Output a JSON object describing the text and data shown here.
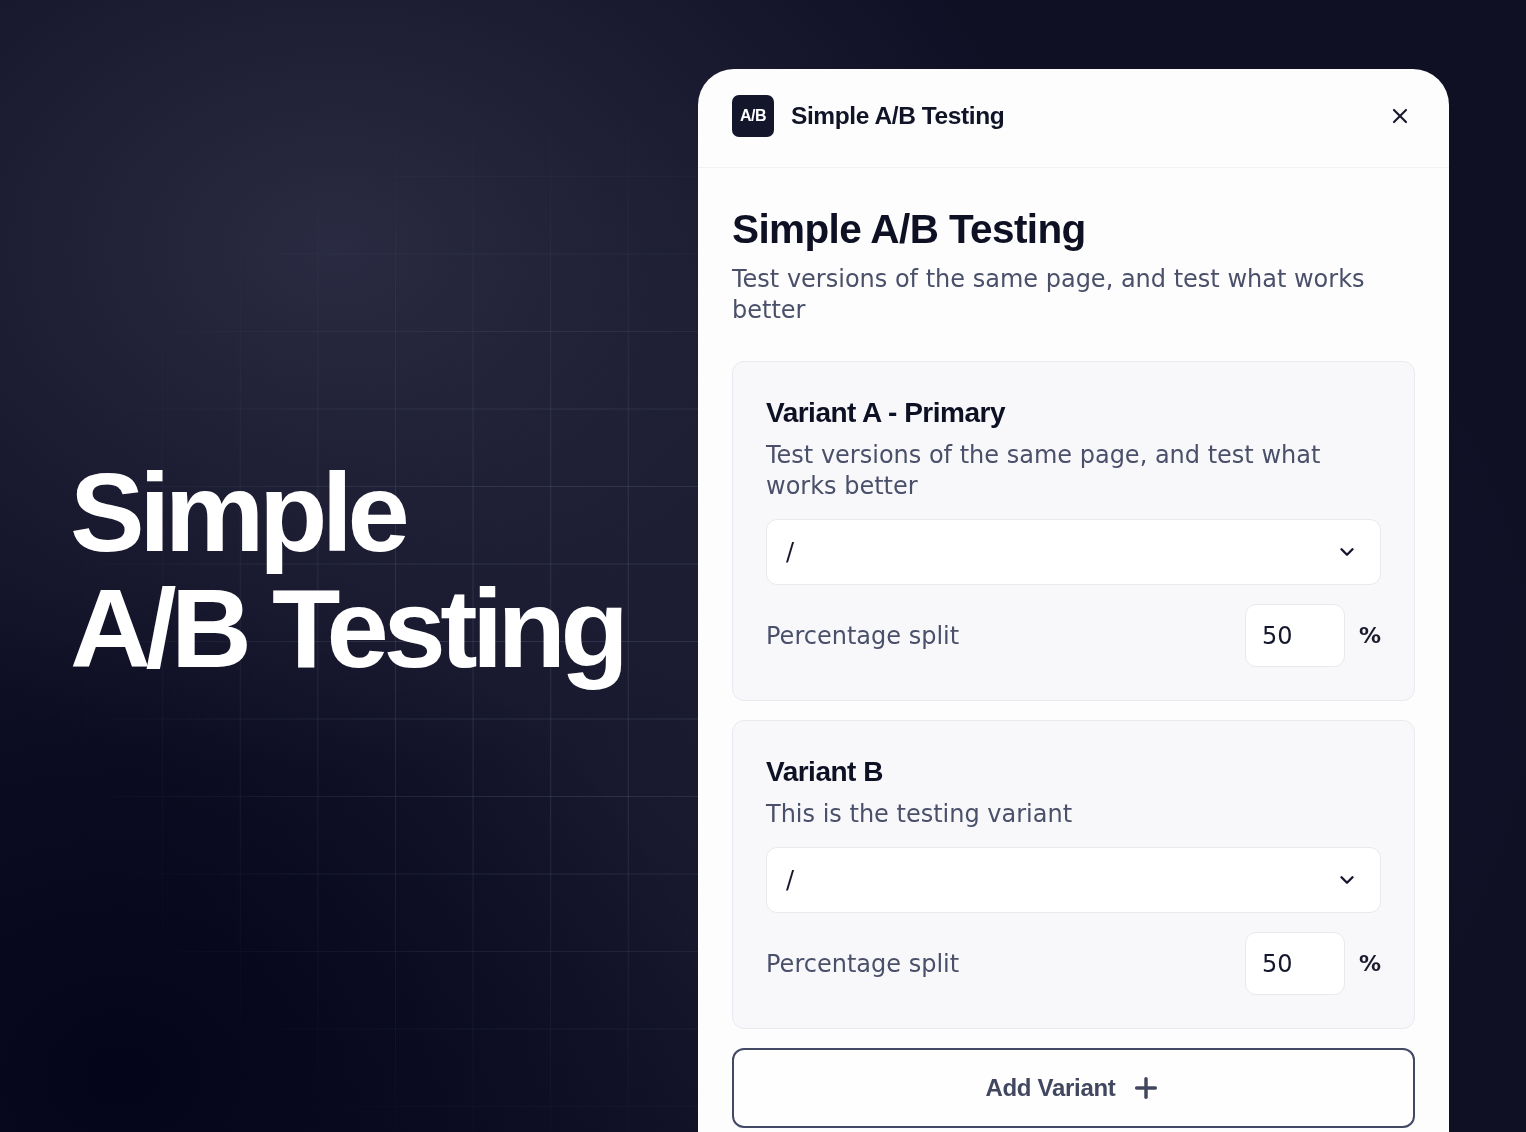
{
  "hero": {
    "title": "Simple\nA/B Testing"
  },
  "dialog": {
    "logo_text": "A/B",
    "title": "Simple A/B Testing"
  },
  "content": {
    "heading": "Simple A/B Testing",
    "subtitle": "Test versions of the same page, and test what works better"
  },
  "variants": [
    {
      "name": "Variant A - Primary",
      "description": "Test versions of the same page, and test what works better",
      "page": "/",
      "split_label": "Percentage split",
      "split_value": "50",
      "unit": "%"
    },
    {
      "name": "Variant B",
      "description": "This is the testing variant",
      "page": "/",
      "split_label": "Percentage split",
      "split_value": "50",
      "unit": "%"
    }
  ],
  "add_button": {
    "label": "Add Variant"
  }
}
